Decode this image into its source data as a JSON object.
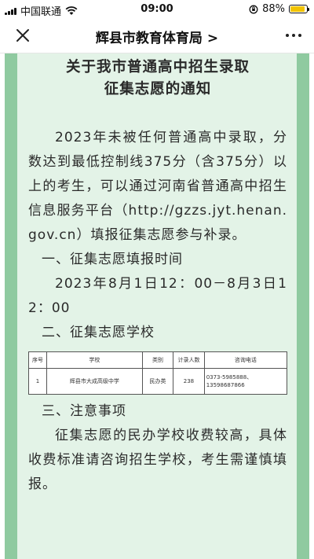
{
  "status_bar": {
    "carrier": "中国联通",
    "time": "09:00",
    "battery": "88%",
    "battery_level": 0.88
  },
  "nav": {
    "title": "辉县市教育体育局",
    "chevron": ">"
  },
  "article": {
    "title_line1": "关于我市普通高中招生录取",
    "title_line2": "征集志愿的通知",
    "intro": "2023年未被任何普通高中录取，分数达到最低控制线375分（含375分）以上的考生，可以通过河南省普通高中招生信息服务平台（http://gzzs.jyt.henan.gov.cn）填报征集志愿参与补录。",
    "section1_heading": "一、征集志愿填报时间",
    "section1_text": "2023年8月1日12：00－8月3日12：00",
    "section2_heading": "二、征集志愿学校",
    "table": {
      "headers": [
        "序号",
        "学校",
        "类别",
        "计录人数",
        "咨询电话"
      ],
      "rows": [
        {
          "no": "1",
          "school": "辉县市大成高级中学",
          "category": "民办类",
          "count": "238",
          "phone1": "0373-5985888、",
          "phone2": "13598687866"
        }
      ]
    },
    "section3_heading": "三、注意事项",
    "section3_text": "征集志愿的民办学校收费较高，具体收费标准请咨询招生学校，考生需谨慎填报。"
  },
  "icons": {
    "close": "close-icon",
    "more": "more-icon",
    "wifi": "wifi-icon",
    "signal": "signal-icon",
    "battery": "battery-icon"
  },
  "colors": {
    "background_panel": "#e3f3e7",
    "border_stripe": "#8fcaa0",
    "battery_fill": "#f2c300"
  }
}
